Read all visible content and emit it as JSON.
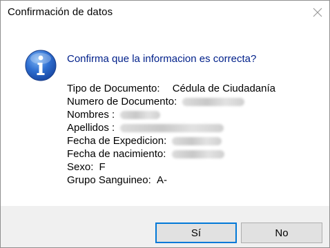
{
  "window": {
    "title": "Confirmación de datos"
  },
  "dialog": {
    "icon": "info-icon",
    "question": "Confirma que la informacion es correcta?",
    "fields": [
      {
        "label": "Tipo de Documento:",
        "value": "Cédula de Ciudadanía",
        "redacted": false
      },
      {
        "label": "Numero de Documento:",
        "value": "",
        "redacted": true
      },
      {
        "label": "Nombres :",
        "value": "",
        "redacted": true
      },
      {
        "label": "Apellidos :",
        "value": "",
        "redacted": true
      },
      {
        "label": "Fecha de Expedicion:",
        "value": "",
        "redacted": true
      },
      {
        "label": "Fecha de nacimiento:",
        "value": "",
        "redacted": true
      },
      {
        "label": "Sexo:",
        "value": "F",
        "redacted": false
      },
      {
        "label": "Grupo Sanguineo:",
        "value": "A-",
        "redacted": false
      }
    ]
  },
  "buttons": {
    "yes_label": "Sí",
    "no_label": "No"
  },
  "colors": {
    "question_text": "#00208a",
    "default_button_border": "#0078d7",
    "footer_bg": "#f0f0f0",
    "button_bg": "#e1e1e1"
  }
}
